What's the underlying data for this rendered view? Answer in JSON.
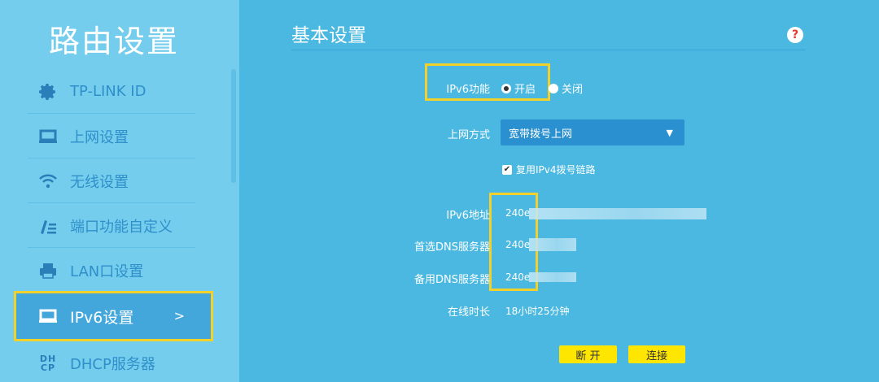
{
  "sidebar": {
    "title": "路由设置",
    "items": [
      {
        "label": "TP-LINK ID"
      },
      {
        "label": "上网设置"
      },
      {
        "label": "无线设置"
      },
      {
        "label": "端口功能自定义"
      },
      {
        "label": "LAN口设置"
      },
      {
        "label": "IPv6设置",
        "arrow": ">"
      },
      {
        "label": "DHCP服务器",
        "icon_text": "DH\nCP"
      }
    ]
  },
  "main": {
    "title": "基本设置",
    "help": "?",
    "ipv6_function": {
      "label": "IPv6功能",
      "options": [
        {
          "label": "开启",
          "selected": true
        },
        {
          "label": "关闭",
          "selected": false
        }
      ]
    },
    "connection_type": {
      "label": "上网方式",
      "value": "宽带拨号上网",
      "arrow": "▼"
    },
    "reuse_ipv4": {
      "label": "复用IPv4拨号链路",
      "checked": true,
      "mark": "✔"
    },
    "ipv6_address": {
      "label": "IPv6地址",
      "value": "240e"
    },
    "primary_dns": {
      "label": "首选DNS服务器",
      "value": "240e"
    },
    "secondary_dns": {
      "label": "备用DNS服务器",
      "value": "240e"
    },
    "online_time": {
      "label": "在线时长",
      "value": "18小时25分钟"
    },
    "buttons": {
      "disconnect": "断 开",
      "connect": "连接"
    }
  },
  "colors": {
    "background": "#4ab8e0",
    "sidebar": "#75cdee",
    "highlight": "#f4d02a",
    "button": "#ffe600",
    "select": "#2a90cf"
  }
}
